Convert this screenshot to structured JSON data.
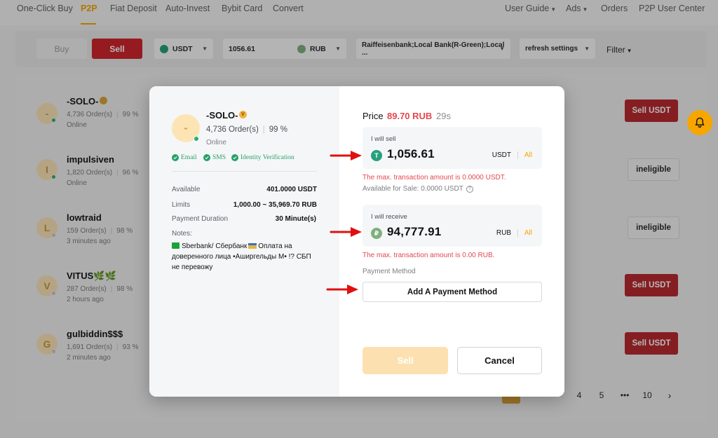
{
  "nav": {
    "items": [
      "One-Click Buy",
      "P2P",
      "Fiat Deposit",
      "Auto-Invest",
      "Bybit Card",
      "Convert"
    ],
    "right": [
      "User Guide",
      "Ads",
      "Orders",
      "P2P User Center"
    ]
  },
  "filters": {
    "buy": "Buy",
    "sell": "Sell",
    "coin": "USDT",
    "amount": "1056.61",
    "fiat": "RUB",
    "payment": "Raiffeisenbank;Local Bank(R-Green);Local ...",
    "refresh": "refresh settings",
    "filter": "Filter"
  },
  "list": [
    {
      "initial": "-",
      "name": "-SOLO-",
      "orders": "4,736 Order(s)",
      "rate": "99 %",
      "status": "Online",
      "action": "Sell USDT"
    },
    {
      "initial": "I",
      "name": "impulsiven",
      "orders": "1,820 Order(s)",
      "rate": "96 %",
      "status": "Online",
      "action": "ineligible"
    },
    {
      "initial": "L",
      "name": "lowtraid",
      "orders": "159 Order(s)",
      "rate": "98 %",
      "status": "3 minutes ago",
      "action": "ineligible"
    },
    {
      "initial": "V",
      "name": "VITUS🌿🌿",
      "orders": "287 Order(s)",
      "rate": "98 %",
      "status": "2 hours ago",
      "action": "Sell USDT"
    },
    {
      "initial": "G",
      "name": "gulbiddin$$$",
      "orders": "1,691 Order(s)",
      "rate": "93 %",
      "status": "2 minutes ago",
      "action": "Sell USDT"
    }
  ],
  "pagination": [
    "4",
    "5",
    "•••",
    "10",
    "›"
  ],
  "colors": {
    "accent": "#f7a600",
    "sell": "#d0262e",
    "error": "#e4474f",
    "verify": "#25a167"
  },
  "modal": {
    "merchant": {
      "initial": "-",
      "name": "-SOLO-",
      "badge": "V",
      "orders": "4,736 Order(s)",
      "rate": "99 %",
      "status": "Online",
      "verifications": [
        "Email",
        "SMS",
        "Identity Verification"
      ]
    },
    "details": {
      "available_label": "Available",
      "available_value": "401.0000 USDT",
      "limits_label": "Limits",
      "limits_value": "1,000.00 ~ 35,969.70 RUB",
      "duration_label": "Payment Duration",
      "duration_value": "30 Minute(s)",
      "notes_label": "Notes:",
      "notes_p1": "Sberbank/ Сбербанк",
      "notes_p2": "Оплата на доверенного лица •Аширгельды М• !? СБП не перевожу"
    },
    "price_label": "Price",
    "price_value": "89.70 RUB",
    "timer": "29s",
    "sell_box": {
      "label": "I will sell",
      "value": "1,056.61",
      "unit": "USDT",
      "all": "All"
    },
    "sell_error": "The max. transaction amount is 0.0000 USDT.",
    "available_for_sale": "Available for Sale: 0.0000 USDT",
    "receive_box": {
      "label": "I will receive",
      "value": "94,777.91",
      "unit": "RUB",
      "all": "All"
    },
    "receive_error": "The max. transaction amount is 0.00 RUB.",
    "payment_method_label": "Payment Method",
    "add_payment_button": "Add A Payment Method",
    "sell_button": "Sell",
    "cancel_button": "Cancel"
  }
}
